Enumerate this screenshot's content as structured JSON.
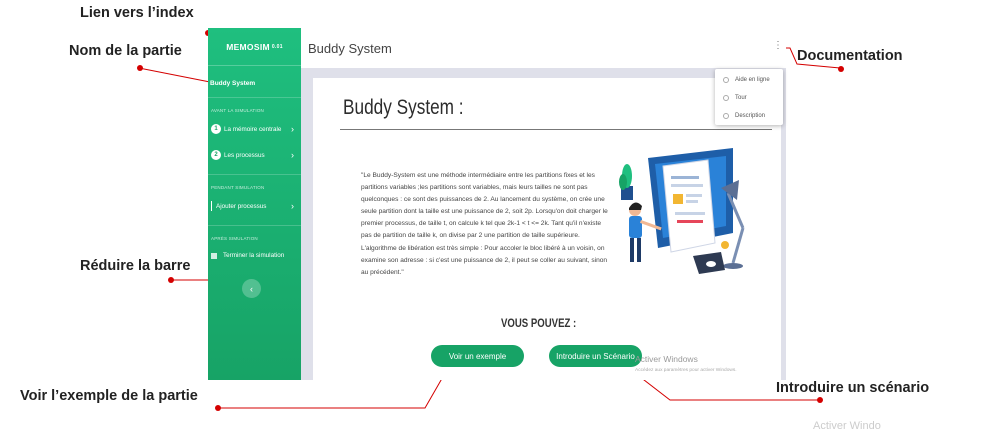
{
  "callouts": {
    "index": "Lien vers l’index",
    "part_name": "Nom de la partie",
    "documentation": "Documentation",
    "collapse": "Réduire la barre",
    "example": "Voir l’exemple de la partie",
    "scenario": "Introduire un scénario"
  },
  "sidebar": {
    "brand": "MEMOSIM",
    "version": "0.01",
    "part": "Buddy System",
    "section_before": "AVANT LA SIMULATION",
    "item1_num": "1",
    "item1": "La mémoire centrale",
    "item2_num": "2",
    "item2": "Les processus",
    "section_during": "PENDANT SIMULATION",
    "item3": "Ajouter processus",
    "section_after": "APRÈS SIMULATION",
    "item4": "Terminer la simulation",
    "collapse_icon": "‹"
  },
  "topbar": {
    "title": "Buddy System",
    "doc_icon": "⋮"
  },
  "menu": [
    "Aide en ligne",
    "Tour",
    "Description"
  ],
  "card": {
    "title": "Buddy System :",
    "description": "\"Le Buddy-System est une méthode intermédiaire entre les partitions fixes et les partitions variables ;les partitions sont variables, mais leurs tailles ne sont pas quelconques : ce sont des puissances de 2. Au lancement du système, on crée une seule partition dont la taille est une puissance de 2, soit 2p. Lorsqu'on doit charger le premier processus, de taille t, on calcule k tel que 2k-1 < t <= 2k. Tant qu'il n'existe pas de partition de taille k, on divise par 2 une partition de taille supérieure. L'algorithme de libération est très simple : Pour accoler le bloc libéré à un voisin, on examine son adresse : si c'est une puissance de 2, il peut se coller au suivant, sinon au précédent.\"",
    "vous_pouvez": "VOUS POUVEZ :",
    "btn_example": "Voir un exemple",
    "btn_scenario": "Introduire un Scénario"
  },
  "watermark": {
    "line1": "Activer Windows",
    "line2": "Accédez aux paramètres pour activer Windows.",
    "faint": "Activer Windo"
  },
  "colors": {
    "accent": "#17a366",
    "callout_dot": "#d40000"
  }
}
